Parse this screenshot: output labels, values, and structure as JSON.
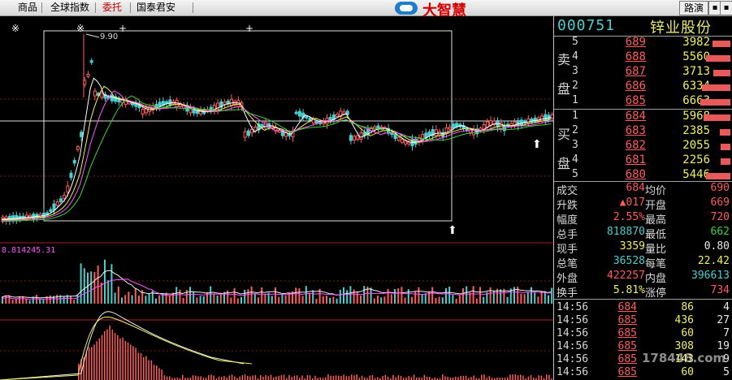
{
  "menu": {
    "items": [
      {
        "label": "商品",
        "accent": false
      },
      {
        "label": "全球指数",
        "accent": false
      },
      {
        "label": "委托",
        "accent": true
      },
      {
        "label": "国泰君安",
        "accent": false
      }
    ],
    "app_name": "大智慧",
    "route_button": "路演",
    "controls": [
      "▪",
      "▪"
    ]
  },
  "chart": {
    "price_high_label": "9.90",
    "volume_label": "8.814245.31",
    "markers": [
      "※",
      "※",
      "+",
      "+"
    ],
    "arrows": [
      "⬆",
      "⬆"
    ]
  },
  "quote": {
    "code": "000751",
    "name": "锌业股份",
    "sell_label": [
      "卖",
      "盘"
    ],
    "buy_label": [
      "买",
      "盘"
    ],
    "sell": [
      {
        "level": "5",
        "price": "689",
        "volume": "3982",
        "bar": 0.55
      },
      {
        "level": "4",
        "price": "688",
        "volume": "5560",
        "bar": 0.75
      },
      {
        "level": "3",
        "price": "687",
        "volume": "3713",
        "bar": 0.52
      },
      {
        "level": "2",
        "price": "686",
        "volume": "6334",
        "bar": 0.88
      },
      {
        "level": "1",
        "price": "685",
        "volume": "6663",
        "bar": 0.92
      }
    ],
    "buy": [
      {
        "level": "1",
        "price": "684",
        "volume": "5968",
        "bar": 0.82
      },
      {
        "level": "2",
        "price": "683",
        "volume": "2385",
        "bar": 0.33
      },
      {
        "level": "3",
        "price": "682",
        "volume": "2055",
        "bar": 0.29
      },
      {
        "level": "4",
        "price": "681",
        "volume": "2256",
        "bar": 0.31
      },
      {
        "level": "5",
        "price": "680",
        "volume": "5446",
        "bar": 0.75
      }
    ],
    "stats": [
      {
        "k1": "成交",
        "v1": "684",
        "c1": "red",
        "k2": "均价",
        "v2": "690",
        "c2": "red"
      },
      {
        "k1": "升跌",
        "v1": "▲017",
        "c1": "red",
        "k2": "开盘",
        "v2": "669",
        "c2": "red"
      },
      {
        "k1": "幅度",
        "v1": "2.55%",
        "c1": "red",
        "k2": "最高",
        "v2": "720",
        "c2": "red"
      },
      {
        "k1": "总手",
        "v1": "818870",
        "c1": "cyan",
        "k2": "最低",
        "v2": "662",
        "c2": "grn"
      },
      {
        "k1": "现手",
        "v1": "3359",
        "c1": "yel",
        "k2": "量比",
        "v2": "0.80",
        "c2": "wht"
      },
      {
        "k1": "总笔",
        "v1": "36528",
        "c1": "cyan",
        "k2": "每笔",
        "v2": "22.42",
        "c2": "yel"
      },
      {
        "k1": "外盘",
        "v1": "422257",
        "c1": "red",
        "k2": "内盘",
        "v2": "396613",
        "c2": "cyan"
      },
      {
        "k1": "换手",
        "v1": "5.81%",
        "c1": "yel",
        "k2": "涨停",
        "v2": "734",
        "c2": "red"
      }
    ],
    "ticks": [
      {
        "time": "14:56",
        "price": "684",
        "vol": "86",
        "num": "4"
      },
      {
        "time": "14:56",
        "price": "685",
        "vol": "436",
        "num": "27"
      },
      {
        "time": "14:56",
        "price": "685",
        "vol": "60",
        "num": "7"
      },
      {
        "time": "14:56",
        "price": "685",
        "vol": "308",
        "num": "19"
      },
      {
        "time": "14:56",
        "price": "685",
        "vol": "143",
        "num": "9"
      },
      {
        "time": "14:56",
        "price": "685",
        "vol": "60",
        "num": "5"
      }
    ],
    "watermark": "178448.com"
  },
  "colors": {
    "up": "#ff5c5c",
    "down": "#48d0d0",
    "ma1": "#ffffff",
    "ma2": "#f0f05c",
    "ma3": "#ff55ff",
    "ma4": "#3ad63a"
  }
}
